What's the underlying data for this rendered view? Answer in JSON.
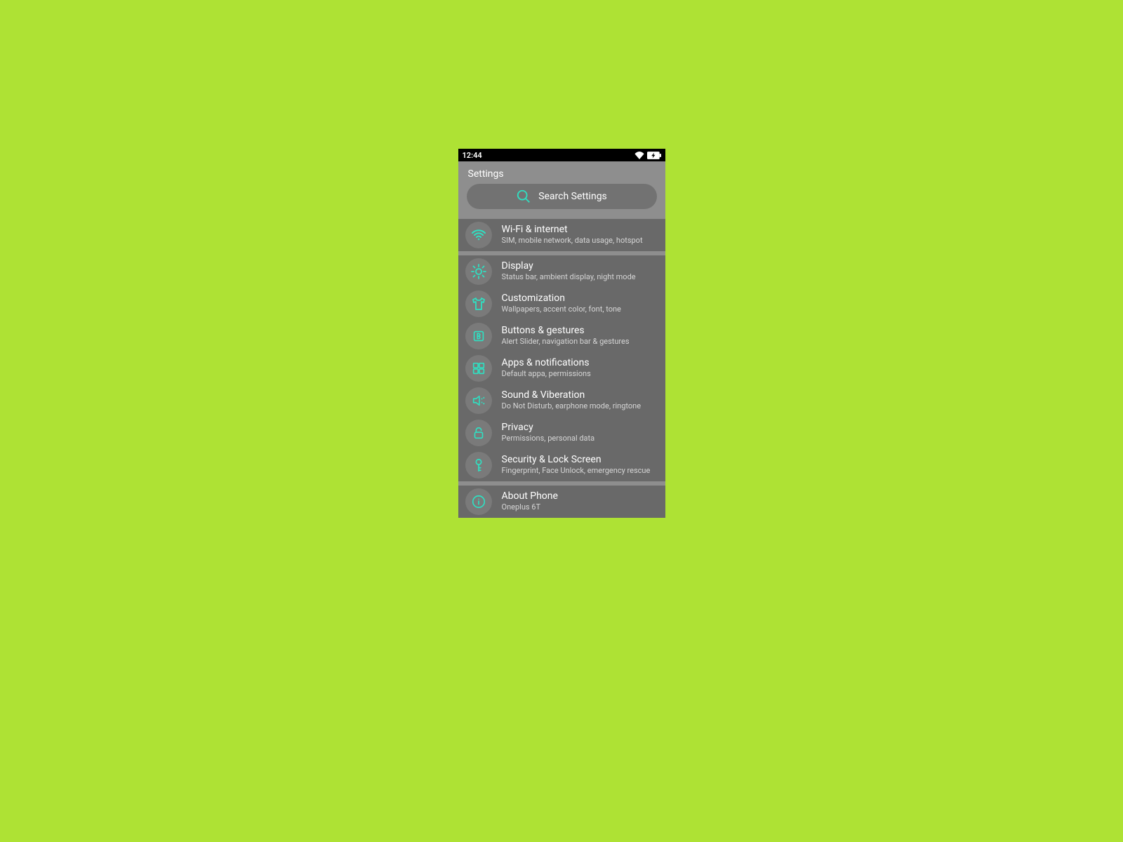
{
  "status": {
    "time": "12:44"
  },
  "header": {
    "title": "Settings",
    "search_placeholder": "Search Settings"
  },
  "groups": [
    {
      "items": [
        {
          "icon": "wifi",
          "title": "Wi-Fi & internet",
          "sub": "SIM, mobile network, data usage, hotspot"
        }
      ]
    },
    {
      "items": [
        {
          "icon": "brightness",
          "title": "Display",
          "sub": "Status bar, ambient display, night mode"
        },
        {
          "icon": "shirt",
          "title": "Customization",
          "sub": "Wallpapers, accent color, font, tone"
        },
        {
          "icon": "button",
          "title": "Buttons & gestures",
          "sub": "Alert Slider, navigation bar & gestures"
        },
        {
          "icon": "apps",
          "title": "Apps &  notifications",
          "sub": "Default appa, permissions"
        },
        {
          "icon": "sound",
          "title": "Sound & Viberation",
          "sub": "Do Not Disturb, earphone mode, ringtone"
        },
        {
          "icon": "lock",
          "title": "Privacy",
          "sub": "Permissions, personal data"
        },
        {
          "icon": "key",
          "title": "Security & Lock Screen",
          "sub": "Fingerprint, Face Unlock, emergency rescue"
        }
      ]
    },
    {
      "items": [
        {
          "icon": "info",
          "title": "About Phone",
          "sub": "Oneplus 6T"
        }
      ]
    }
  ],
  "colors": {
    "accent": "#2fe0c2"
  }
}
